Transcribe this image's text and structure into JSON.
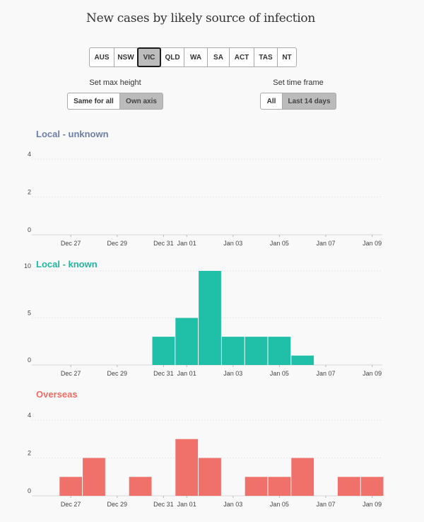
{
  "title": "New cases by likely source of infection",
  "regions": [
    {
      "label": "AUS",
      "active": false
    },
    {
      "label": "NSW",
      "active": false
    },
    {
      "label": "VIC",
      "active": true
    },
    {
      "label": "QLD",
      "active": false
    },
    {
      "label": "WA",
      "active": false
    },
    {
      "label": "SA",
      "active": false
    },
    {
      "label": "ACT",
      "active": false
    },
    {
      "label": "TAS",
      "active": false
    },
    {
      "label": "NT",
      "active": false
    }
  ],
  "controls": {
    "max_height": {
      "label": "Set max height",
      "options": [
        "Same for all",
        "Own axis"
      ],
      "selected": "Own axis"
    },
    "time_frame": {
      "label": "Set time frame",
      "options": [
        "All",
        "Last 14 days"
      ],
      "selected": "Last 14 days"
    }
  },
  "chart_data": [
    {
      "type": "bar",
      "title": "Local - unknown",
      "color": "#6b7fa8",
      "bar_color": "#6b7fa8",
      "x": [
        "Dec 26",
        "Dec 27",
        "Dec 28",
        "Dec 29",
        "Dec 30",
        "Dec 31",
        "Jan 01",
        "Jan 02",
        "Jan 03",
        "Jan 04",
        "Jan 05",
        "Jan 06",
        "Jan 07",
        "Jan 08",
        "Jan 09"
      ],
      "values": [
        0,
        0,
        0,
        0,
        0,
        0,
        0,
        0,
        0,
        0,
        0,
        0,
        0,
        0,
        0
      ],
      "x_tick_labels": [
        "Dec 27",
        "Dec 29",
        "Dec 31",
        "Jan 01",
        "Jan 03",
        "Jan 05",
        "Jan 07",
        "Jan 09"
      ],
      "y_ticks": [
        0,
        2,
        4
      ],
      "ylim": [
        0,
        4
      ],
      "grid": true
    },
    {
      "type": "bar",
      "title": "Local - known",
      "color": "#1fb5a0",
      "bar_color": "#20bfa7",
      "x": [
        "Dec 26",
        "Dec 27",
        "Dec 28",
        "Dec 29",
        "Dec 30",
        "Dec 31",
        "Jan 01",
        "Jan 02",
        "Jan 03",
        "Jan 04",
        "Jan 05",
        "Jan 06",
        "Jan 07",
        "Jan 08",
        "Jan 09"
      ],
      "values": [
        0,
        0,
        0,
        0,
        0,
        3,
        5,
        10,
        3,
        3,
        3,
        1,
        0,
        0,
        0
      ],
      "x_tick_labels": [
        "Dec 27",
        "Dec 29",
        "Dec 31",
        "Jan 01",
        "Jan 03",
        "Jan 05",
        "Jan 07",
        "Jan 09"
      ],
      "y_ticks": [
        0,
        5,
        10
      ],
      "ylim": [
        0,
        10
      ],
      "grid": true
    },
    {
      "type": "bar",
      "title": "Overseas",
      "color": "#ef6b63",
      "bar_color": "#f0706a",
      "x": [
        "Dec 26",
        "Dec 27",
        "Dec 28",
        "Dec 29",
        "Dec 30",
        "Dec 31",
        "Jan 01",
        "Jan 02",
        "Jan 03",
        "Jan 04",
        "Jan 05",
        "Jan 06",
        "Jan 07",
        "Jan 08",
        "Jan 09"
      ],
      "values": [
        0,
        1,
        2,
        0,
        1,
        0,
        3,
        2,
        0,
        1,
        1,
        2,
        0,
        1,
        1
      ],
      "x_tick_labels": [
        "Dec 27",
        "Dec 29",
        "Dec 31",
        "Jan 01",
        "Jan 03",
        "Jan 05",
        "Jan 07",
        "Jan 09"
      ],
      "y_ticks": [
        0,
        2,
        4
      ],
      "ylim": [
        0,
        4
      ],
      "grid": true
    }
  ]
}
